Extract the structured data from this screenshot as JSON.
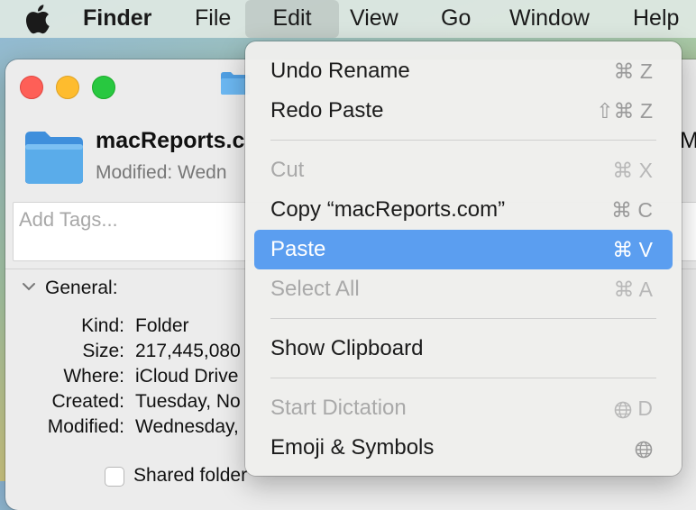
{
  "menubar": {
    "apple": "apple-logo",
    "items": [
      "Finder",
      "File",
      "Edit",
      "View",
      "Go",
      "Window",
      "Help"
    ]
  },
  "window": {
    "name": "macReports.c",
    "modified": "Modified: Wedn",
    "right_edge": "M",
    "tags_placeholder": "Add Tags...",
    "general": "General:",
    "rows": [
      {
        "key": "Kind:",
        "value": "Folder"
      },
      {
        "key": "Size:",
        "value": "217,445,080"
      },
      {
        "key": "Where:",
        "value": "iCloud Drive"
      },
      {
        "key": "Created:",
        "value": "Tuesday, No"
      },
      {
        "key": "Modified:",
        "value": "Wednesday,"
      }
    ],
    "shared_label": "Shared folder"
  },
  "edit_menu": {
    "items": [
      {
        "label": "Undo Rename",
        "shortcut": "⌘ Z",
        "state": "enabled"
      },
      {
        "label": "Redo Paste",
        "shortcut": "⇧⌘ Z",
        "state": "enabled"
      },
      {
        "label": "Cut",
        "shortcut": "⌘ X",
        "state": "disabled"
      },
      {
        "label": "Copy “macReports.com”",
        "shortcut": "⌘ C",
        "state": "enabled"
      },
      {
        "label": "Paste",
        "shortcut": "⌘ V",
        "state": "selected"
      },
      {
        "label": "Select All",
        "shortcut": "⌘ A",
        "state": "disabled"
      },
      {
        "label": "Show Clipboard",
        "shortcut": "",
        "state": "enabled"
      },
      {
        "label": "Start Dictation",
        "shortcut": "D",
        "state": "disabled",
        "icon": "globe-icon"
      },
      {
        "label": "Emoji & Symbols",
        "shortcut": "",
        "state": "enabled",
        "icon": "globe-icon"
      }
    ]
  },
  "colors": {
    "selection": "#5b9ef0",
    "close": "#fe5f57",
    "minimize": "#febc2e",
    "zoom": "#28c840",
    "folder": "#5aacea"
  }
}
